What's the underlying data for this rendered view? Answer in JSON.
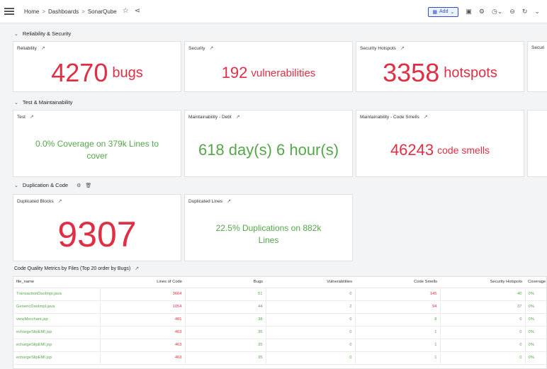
{
  "breadcrumb": {
    "home": "Home",
    "dashboards": "Dashboards",
    "current": "SonarQube",
    "sep": ">"
  },
  "toolbar": {
    "add_label": "Add"
  },
  "sections": {
    "reliability": "Reliability & Security",
    "test": "Test & Maintainability",
    "duplication": "Duplication & Code"
  },
  "panels": {
    "reliability": {
      "title": "Reliability",
      "value": "4270",
      "unit": "bugs"
    },
    "security": {
      "title": "Security",
      "value": "192",
      "unit": "vulnerabilities"
    },
    "hotspots": {
      "title": "Security Hotspots",
      "value": "3358",
      "unit": "hotspots"
    },
    "security_cut": {
      "title": "Securi"
    },
    "test": {
      "title": "Test",
      "text": "0.0% Coverage on 379k Lines to cover"
    },
    "debt": {
      "title": "Maintainability - Debt",
      "text": "618 day(s) 6 hour(s)"
    },
    "smells": {
      "title": "Maintainability - Code Smells",
      "value": "46243",
      "unit": "code smells"
    },
    "dup_blocks": {
      "title": "Duplicated Blocks",
      "value": "9307"
    },
    "dup_lines": {
      "title": "Duplicated Lines",
      "text": "22.5% Duplications on 882k Lines"
    }
  },
  "table": {
    "title": "Code Quality Metrics by Files (Top 20 order by Bugs)",
    "headers": [
      "file_name",
      "Lines of Code",
      "Bugs",
      "Vulnerabilities",
      "Code Smells",
      "Security Hotspots",
      "Coverage"
    ],
    "rows": [
      [
        "TransactionDaoImpl.java",
        "3664",
        "51",
        "0",
        "145",
        "40",
        "0%"
      ],
      [
        "GenericDaoImpl.java",
        "1054",
        "44",
        "2",
        "94",
        "37",
        "0%"
      ],
      [
        "viewMerchant.jsp",
        "481",
        "38",
        "0",
        "8",
        "0",
        "0%"
      ],
      [
        "echargeSlipEMI.jsp",
        "463",
        "35",
        "0",
        "1",
        "0",
        "0%"
      ],
      [
        "echargeSlipEMI.jsp",
        "463",
        "35",
        "0",
        "1",
        "0",
        "0%"
      ],
      [
        "echargeSlipEMI.jsp",
        "463",
        "35",
        "0",
        "1",
        "0",
        "0%"
      ]
    ]
  },
  "colors": {
    "red": "#e02f44",
    "green": "#56a64b",
    "accent": "#2b4fd0"
  }
}
